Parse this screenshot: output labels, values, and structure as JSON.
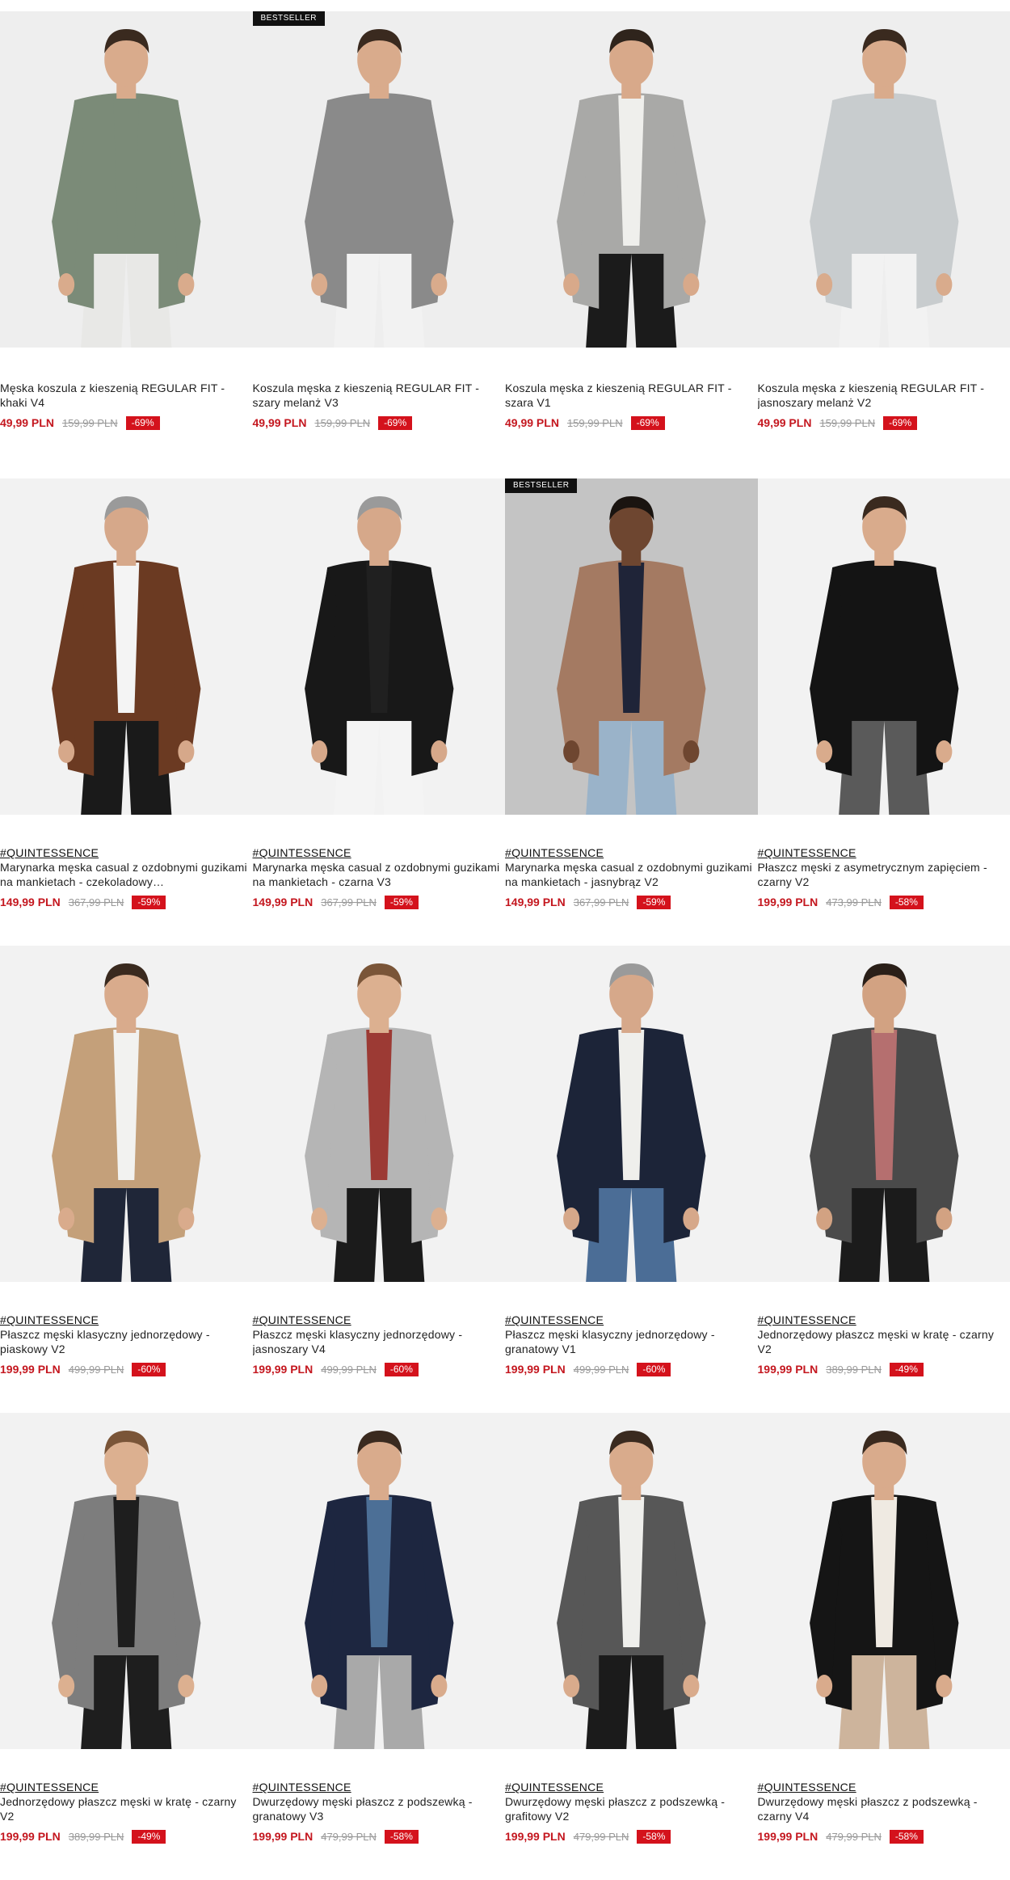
{
  "colors": {
    "price": "#c4171f",
    "discount_bg": "#d4121c",
    "badge_bg": "#111111"
  },
  "products": [
    {
      "badge": "",
      "brand": "",
      "title": "Męska koszula z kieszenią REGULAR FIT - khaki V4",
      "price": "49,99 PLN",
      "old_price": "159,99 PLN",
      "discount": "-69%",
      "bg": "#eeeeee",
      "garment": "#7b8b78",
      "inner": "#7b8b78",
      "pants": "#e8e8e6",
      "hair": "#3a2a1f",
      "skin": "#d9ab8c"
    },
    {
      "badge": "BESTSELLER",
      "brand": "",
      "title": "Koszula męska z kieszenią REGULAR FIT - szary melanż V3",
      "price": "49,99 PLN",
      "old_price": "159,99 PLN",
      "discount": "-69%",
      "bg": "#eeeeee",
      "garment": "#8a8a8a",
      "inner": "#8a8a8a",
      "pants": "#f2f2f2",
      "hair": "#3a2a1f",
      "skin": "#d9ab8c"
    },
    {
      "badge": "",
      "brand": "",
      "title": "Koszula męska z kieszenią REGULAR FIT - szara V1",
      "price": "49,99 PLN",
      "old_price": "159,99 PLN",
      "discount": "-69%",
      "bg": "#eeeeee",
      "garment": "#a9a9a7",
      "inner": "#efefec",
      "pants": "#1b1b1b",
      "hair": "#2f241c",
      "skin": "#d8a98a"
    },
    {
      "badge": "",
      "brand": "",
      "title": "Koszula męska z kieszenią REGULAR FIT - jasnoszary melanż V2",
      "price": "49,99 PLN",
      "old_price": "159,99 PLN",
      "discount": "-69%",
      "bg": "#eeeeee",
      "garment": "#c8ccce",
      "inner": "#c8ccce",
      "pants": "#f2f2f2",
      "hair": "#3a2a1f",
      "skin": "#d9ab8c"
    },
    {
      "badge": "",
      "brand": "#QUINTESSENCE",
      "title": "Marynarka męska casual z ozdobnymi guzikami na mankietach - czekoladowy…",
      "price": "149,99 PLN",
      "old_price": "367,99 PLN",
      "discount": "-59%",
      "bg": "#f2f2f2",
      "garment": "#6b3a22",
      "inner": "#f4f4f4",
      "pants": "#1a1a1a",
      "hair": "#9a9a9a",
      "skin": "#d6a88a"
    },
    {
      "badge": "",
      "brand": "#QUINTESSENCE",
      "title": "Marynarka męska casual z ozdobnymi guzikami na mankietach - czarna V3",
      "price": "149,99 PLN",
      "old_price": "367,99 PLN",
      "discount": "-59%",
      "bg": "#f2f2f2",
      "garment": "#181818",
      "inner": "#202020",
      "pants": "#f4f4f4",
      "hair": "#9a9a9a",
      "skin": "#d6a88a"
    },
    {
      "badge": "BESTSELLER",
      "brand": "#QUINTESSENCE",
      "title": "Marynarka męska casual z ozdobnymi guzikami na mankietach - jasnybrąz V2",
      "price": "149,99 PLN",
      "old_price": "367,99 PLN",
      "discount": "-59%",
      "bg": "#c4c4c4",
      "garment": "#a47a62",
      "inner": "#1f2438",
      "pants": "#9ab3c9",
      "hair": "#1a1410",
      "skin": "#6e4630"
    },
    {
      "badge": "",
      "brand": "#QUINTESSENCE",
      "title": "Płaszcz męski z asymetrycznym zapięciem - czarny V2",
      "price": "199,99 PLN",
      "old_price": "473,99 PLN",
      "discount": "-58%",
      "bg": "#f2f2f2",
      "garment": "#141414",
      "inner": "#141414",
      "pants": "#5a5a5a",
      "hair": "#3a2a1f",
      "skin": "#d9ab8c"
    },
    {
      "badge": "",
      "brand": "#QUINTESSENCE",
      "title": "Płaszcz męski klasyczny jednorzędowy - piaskowy V2",
      "price": "199,99 PLN",
      "old_price": "499,99 PLN",
      "discount": "-60%",
      "bg": "#f2f2f2",
      "garment": "#c4a07a",
      "inner": "#f2f2f0",
      "pants": "#1f2638",
      "hair": "#3a2a1f",
      "skin": "#d9ab8c"
    },
    {
      "badge": "",
      "brand": "#QUINTESSENCE",
      "title": "Płaszcz męski klasyczny jednorzędowy - jasnoszary V4",
      "price": "199,99 PLN",
      "old_price": "499,99 PLN",
      "discount": "-60%",
      "bg": "#f2f2f2",
      "garment": "#b5b5b5",
      "inner": "#9c3a34",
      "pants": "#1b1b1b",
      "hair": "#7a5538",
      "skin": "#dcb090"
    },
    {
      "badge": "",
      "brand": "#QUINTESSENCE",
      "title": "Płaszcz męski klasyczny jednorzędowy - granatowy V1",
      "price": "199,99 PLN",
      "old_price": "499,99 PLN",
      "discount": "-60%",
      "bg": "#f2f2f2",
      "garment": "#1c2438",
      "inner": "#efefec",
      "pants": "#4b6d96",
      "hair": "#9a9a9a",
      "skin": "#d6a88a"
    },
    {
      "badge": "",
      "brand": "#QUINTESSENCE",
      "title": "Jednorzędowy płaszcz męski w kratę - czarny V2",
      "price": "199,99 PLN",
      "old_price": "389,99 PLN",
      "discount": "-49%",
      "bg": "#f2f2f2",
      "garment": "#4a4a4a",
      "inner": "#b56f6f",
      "pants": "#1b1b1b",
      "hair": "#2a1f18",
      "skin": "#d2a282"
    },
    {
      "badge": "",
      "brand": "#QUINTESSENCE",
      "title": "Jednorzędowy płaszcz męski w kratę - czarny V2",
      "price": "199,99 PLN",
      "old_price": "389,99 PLN",
      "discount": "-49%",
      "bg": "#f2f2f2",
      "garment": "#7d7d7d",
      "inner": "#1e1e1e",
      "pants": "#1e1e1e",
      "hair": "#7a5538",
      "skin": "#dcb090"
    },
    {
      "badge": "",
      "brand": "#QUINTESSENCE",
      "title": "Dwurzędowy męski płaszcz z podszewką - granatowy V3",
      "price": "199,99 PLN",
      "old_price": "479,99 PLN",
      "discount": "-58%",
      "bg": "#f2f2f2",
      "garment": "#1d2640",
      "inner": "#4c6f96",
      "pants": "#a9a9a9",
      "hair": "#3a2a1f",
      "skin": "#d9ab8c"
    },
    {
      "badge": "",
      "brand": "#QUINTESSENCE",
      "title": "Dwurzędowy męski płaszcz z podszewką - grafitowy V2",
      "price": "199,99 PLN",
      "old_price": "479,99 PLN",
      "discount": "-58%",
      "bg": "#f2f2f2",
      "garment": "#575757",
      "inner": "#efefec",
      "pants": "#1b1b1b",
      "hair": "#3a2a1f",
      "skin": "#d9ab8c"
    },
    {
      "badge": "",
      "brand": "#QUINTESSENCE",
      "title": "Dwurzędowy męski płaszcz z podszewką - czarny V4",
      "price": "199,99 PLN",
      "old_price": "479,99 PLN",
      "discount": "-58%",
      "bg": "#f2f2f2",
      "garment": "#151515",
      "inner": "#efeae2",
      "pants": "#cdb49c",
      "hair": "#3a2a1f",
      "skin": "#d9ab8c"
    }
  ]
}
